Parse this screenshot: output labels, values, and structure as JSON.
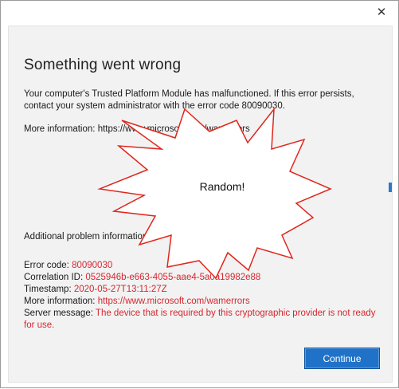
{
  "window": {
    "close_icon": "close-icon"
  },
  "dialog": {
    "title": "Something went wrong",
    "message": "Your computer's Trusted Platform Module has malfunctioned. If this error persists, contact your system administrator with the error code 80090030.",
    "more_info_top_label": "More information: ",
    "more_info_top_url": "https://www.microsoft.com/wamerrors",
    "additional_heading": "Additional problem information",
    "details": {
      "error_code_label": "Error code: ",
      "error_code_value": "80090030",
      "correlation_label": "Correlation ID: ",
      "correlation_value": "0525946b-e663-4055-aae4-5a0a19982e88",
      "timestamp_label": "Timestamp: ",
      "timestamp_value": "2020-05-27T13:11:27Z",
      "more_info_label": "More information: ",
      "more_info_value": "https://www.microsoft.com/wamerrors",
      "server_message_label": "Server message: ",
      "server_message_value": "The device that is required by this cryptographic provider is not ready for use."
    },
    "continue_label": "Continue"
  },
  "overlay": {
    "label": "Random!"
  },
  "colors": {
    "accent": "#1f72c8",
    "error_text": "#d6272e",
    "burst_stroke": "#e0261c",
    "dialog_bg": "#f2f2f2"
  }
}
